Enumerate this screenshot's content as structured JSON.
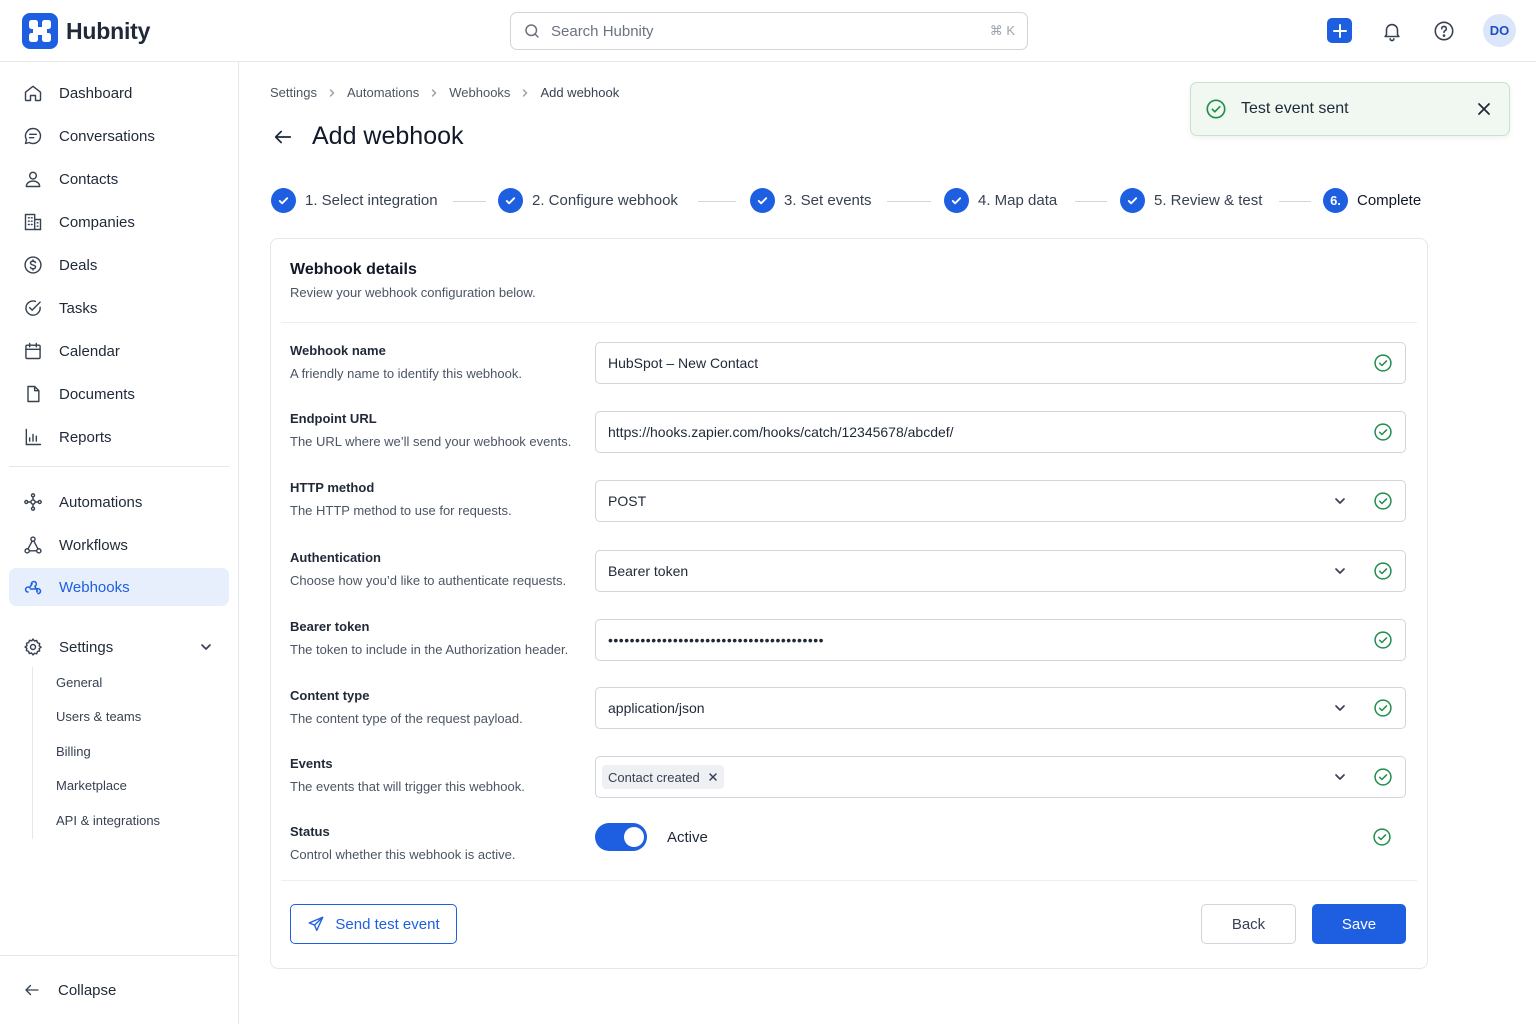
{
  "app": {
    "name": "Hubnity"
  },
  "search": {
    "placeholder": "Search Hubnity",
    "shortcut": "⌘ K"
  },
  "user": {
    "initials": "DO"
  },
  "sidebar": {
    "items": [
      {
        "label": "Dashboard",
        "icon": "home-icon"
      },
      {
        "label": "Conversations",
        "icon": "chat-icon"
      },
      {
        "label": "Contacts",
        "icon": "user-icon"
      },
      {
        "label": "Companies",
        "icon": "building-icon"
      },
      {
        "label": "Deals",
        "icon": "dollar-icon"
      },
      {
        "label": "Tasks",
        "icon": "check-circle-icon"
      },
      {
        "label": "Calendar",
        "icon": "calendar-icon"
      },
      {
        "label": "Documents",
        "icon": "document-icon"
      },
      {
        "label": "Reports",
        "icon": "bar-chart-icon"
      }
    ],
    "items2": [
      {
        "label": "Automations",
        "icon": "automation-icon"
      },
      {
        "label": "Workflows",
        "icon": "workflow-icon"
      },
      {
        "label": "Webhooks",
        "icon": "webhook-icon",
        "active": true
      }
    ],
    "settings": {
      "label": "Settings",
      "children": [
        "General",
        "Users & teams",
        "Billing",
        "Marketplace",
        "API & integrations"
      ]
    },
    "collapse_label": "Collapse"
  },
  "breadcrumb": [
    "Settings",
    "Automations",
    "Webhooks",
    "Add webhook"
  ],
  "page": {
    "title": "Add webhook"
  },
  "steps": [
    {
      "label": "1. Select integration",
      "done": true
    },
    {
      "label": "2. Configure webhook",
      "done": true
    },
    {
      "label": "3. Set events",
      "done": true
    },
    {
      "label": "4. Map data",
      "done": true
    },
    {
      "label": "5. Review & test",
      "done": true
    },
    {
      "number": "6.",
      "label": "Complete",
      "current": true
    }
  ],
  "toast": {
    "message": "Test event sent"
  },
  "card": {
    "title": "Webhook details",
    "subtitle": "Review your webhook configuration below.",
    "fields": {
      "name": {
        "label": "Webhook name",
        "help": "A friendly name to identify this webhook.",
        "value": "HubSpot – New Contact"
      },
      "url": {
        "label": "Endpoint URL",
        "help": "The URL where we’ll send your webhook events.",
        "value": "https://hooks.zapier.com/hooks/catch/12345678/abcdef/"
      },
      "method": {
        "label": "HTTP method",
        "help": "The HTTP method to use for requests.",
        "value": "POST"
      },
      "auth": {
        "label": "Authentication",
        "help": "Choose how you’d like to authenticate requests.",
        "value": "Bearer token"
      },
      "token": {
        "label": "Bearer token",
        "help": "The token to include in the Authorization header.",
        "value": "••••••••••••••••••••••••••••••••••••••••"
      },
      "content_type": {
        "label": "Content type",
        "help": "The content type of the request payload.",
        "value": "application/json"
      },
      "events": {
        "label": "Events",
        "help": "The events that will trigger this webhook.",
        "chips": [
          "Contact created"
        ]
      },
      "status": {
        "label": "Status",
        "help": "Control whether this webhook is active.",
        "value": "Active",
        "enabled": true
      }
    },
    "buttons": {
      "test": "Send test event",
      "back": "Back",
      "save": "Save"
    }
  },
  "colors": {
    "accent": "#1d5fe0",
    "success": "#1e8e4a"
  }
}
